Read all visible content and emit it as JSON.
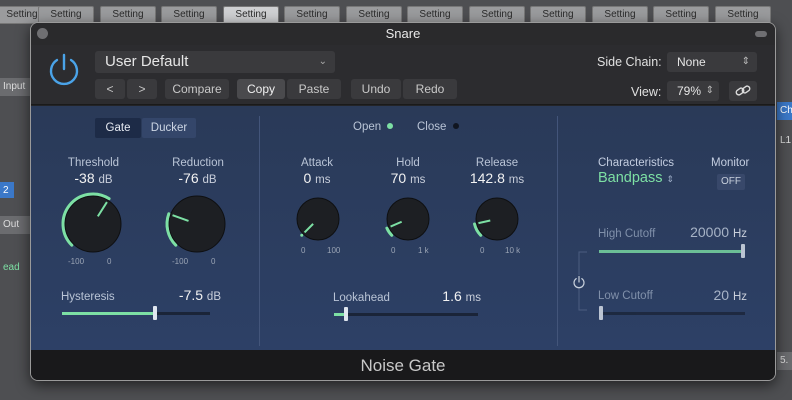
{
  "background": {
    "strip_label": "Setting",
    "left_side": [
      "Input",
      "2",
      "Out",
      "ead"
    ],
    "right_side": [
      "Ch",
      "L1",
      "5."
    ]
  },
  "window": {
    "title": "Snare",
    "preset": "User Default",
    "compare_label": "Compare",
    "copy_label": "Copy",
    "paste_label": "Paste",
    "undo_label": "Undo",
    "redo_label": "Redo",
    "prev_symbol": "<",
    "next_symbol": ">",
    "side_chain_label": "Side Chain:",
    "side_chain_value": "None",
    "view_label": "View:",
    "view_value": "79%"
  },
  "gate_section": {
    "mode_gate": "Gate",
    "mode_ducker": "Ducker",
    "threshold": {
      "label": "Threshold",
      "value": "-38",
      "unit": "dB",
      "min": "-100",
      "max": "0"
    },
    "reduction": {
      "label": "Reduction",
      "value": "-76",
      "unit": "dB",
      "min": "-100",
      "max": "0"
    },
    "hysteresis": {
      "label": "Hysteresis",
      "value": "-7.5",
      "unit": "dB",
      "level": 0.63
    }
  },
  "time_section": {
    "open_label": "Open",
    "close_label": "Close",
    "attack": {
      "label": "Attack",
      "value": "0",
      "unit": "ms",
      "min": "0",
      "max": "100"
    },
    "hold": {
      "label": "Hold",
      "value": "70",
      "unit": "ms",
      "min": "0",
      "max": "1 k"
    },
    "release": {
      "label": "Release",
      "value": "142.8",
      "unit": "ms",
      "min": "0",
      "max": "10 k"
    },
    "lookahead": {
      "label": "Lookahead",
      "value": "1.6",
      "unit": "ms",
      "level": 0.08
    }
  },
  "filter_section": {
    "characteristics_label": "Characteristics",
    "characteristics_value": "Bandpass",
    "monitor_label": "Monitor",
    "monitor_value": "OFF",
    "high_cutoff": {
      "label": "High Cutoff",
      "value": "20000",
      "unit": "Hz",
      "level": 1.0
    },
    "low_cutoff": {
      "label": "Low Cutoff",
      "value": "20",
      "unit": "Hz",
      "level": 0.0
    }
  },
  "plugin_name": "Noise Gate",
  "colors": {
    "accent": "#7de0a4",
    "power": "#4aa3e8",
    "panel": "#2d4066"
  }
}
